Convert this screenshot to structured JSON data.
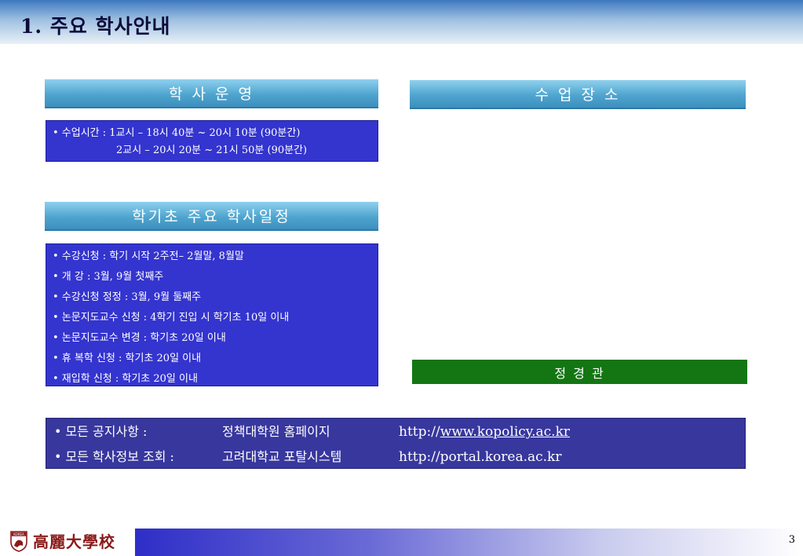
{
  "header": {
    "title": "1. 주요 학사안내"
  },
  "sections": {
    "academic_ops": "학 사 운 영",
    "class_location": "수 업 장 소",
    "semester_schedule": "학기초  주요 학사일정"
  },
  "class_time": {
    "line1": "• 수업시간 : 1교시 – 18시 40분 ~ 20시 10분 (90분간)",
    "line2": "2교시 – 20시 20분 ~ 21시 50분 (90분간)"
  },
  "schedule_items": [
    "• 수강신청 : 학기 시작 2주전– 2월말, 8월말",
    "• 개      강 : 3월, 9월 첫째주",
    "• 수강신청 정정 : 3월, 9월 둘째주",
    "• 논문지도교수 신청 : 4학기 진입 시 학기초 10일 이내",
    "• 논문지도교수 변경 : 학기초 20일 이내",
    "• 휴 복학 신청 : 학기초 20일 이내",
    "• 재입학 신청 : 학기초 20일 이내"
  ],
  "location": {
    "building": "정   경   관"
  },
  "notice": {
    "row1": {
      "label": "• 모든 공지사항 :",
      "target": "정책대학원 홈페이지",
      "url_prefix": "http://",
      "url_link": "www.kopolicy.ac.kr"
    },
    "row2": {
      "label": "• 모든 학사정보 조회 :",
      "target": "고려대학교 포탈시스템",
      "url": "http://portal.korea.ac.kr"
    }
  },
  "footer": {
    "logo_text": "高麗大學校",
    "emblem_text": "KOREA",
    "page_number": "3"
  }
}
